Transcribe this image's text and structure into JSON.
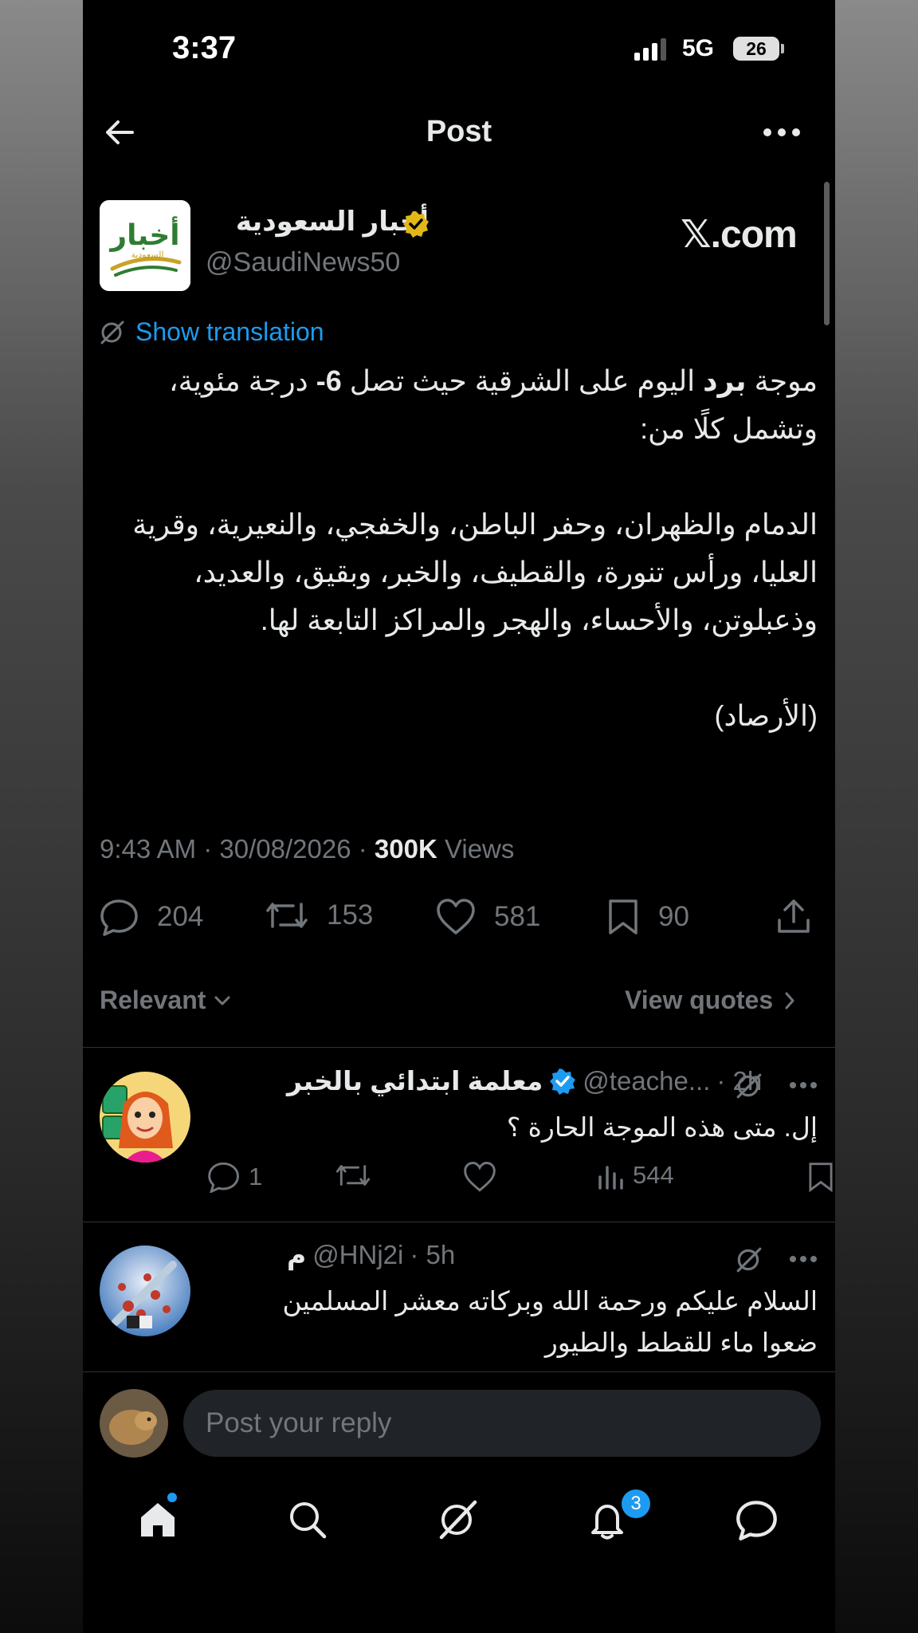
{
  "status_bar": {
    "time": "3:37",
    "network": "5G",
    "battery": "26"
  },
  "header": {
    "title": "Post"
  },
  "post": {
    "author_name": "أخبار السعودية",
    "author_handle": "@SaudiNews50",
    "source_brand": "𝕏.com",
    "avatar_logo_text": "أخبار",
    "avatar_logo_sub": "السعودية",
    "show_translation": "Show translation",
    "body_pre": "موجة ",
    "body_bold": "برد",
    "body_mid": " اليوم على الشرقية حيث تصل ",
    "body_temp": "6-",
    "body_rest": " درجة مئوية، وتشمل كلًا من:\n\nالدمام والظهران، وحفر الباطن، والخفجي، والنعيرية، وقرية العليا، ورأس تنورة، والقطيف، والخبر، وبقيق، والعديد، وذعبلوتن، والأحساء، والهجر والمراكز التابعة لها.\n\n(الأرصاد)",
    "timestamp": "9:43 AM · 30/08/2026 · ",
    "views_count": "300K",
    "views_label": " Views",
    "stats": {
      "replies": "204",
      "reposts": "153",
      "likes": "581",
      "bookmarks": "90"
    }
  },
  "filters": {
    "relevant": "Relevant",
    "view_quotes": "View quotes"
  },
  "replies": [
    {
      "name": "معلمة ابتدائي بالخبر",
      "handle": "@teache...",
      "time": "· 2h",
      "text": "إل. متى هذه الموجة الحارة ؟",
      "replies": "1",
      "views": "544"
    },
    {
      "name": "م",
      "handle": "@HNj2i",
      "time": "· 5h",
      "text": "السلام عليكم ورحمة الله وبركاته معشر المسلمين\nضعوا ماء للقطط والطيور"
    }
  ],
  "composer": {
    "placeholder": "Post your reply"
  },
  "tabbar": {
    "notifications_badge": "3"
  },
  "colors": {
    "accent": "#1d9bf0",
    "verified_gold": "#e2b719",
    "background": "#000000",
    "muted": "#71767b"
  }
}
